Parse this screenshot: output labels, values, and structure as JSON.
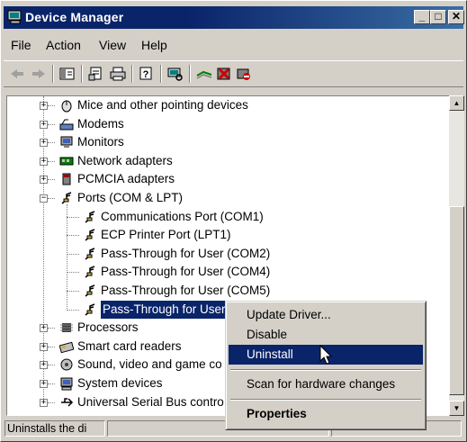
{
  "window": {
    "title": "Device Manager"
  },
  "menubar": {
    "items": [
      "File",
      "Action",
      "View",
      "Help"
    ]
  },
  "toolbar": {
    "icons": [
      "back-icon",
      "forward-icon",
      "show-hide-tree-icon",
      "properties-icon",
      "print-icon",
      "help-icon",
      "scan-hardware-icon",
      "update-driver-icon",
      "uninstall-icon",
      "disable-icon"
    ]
  },
  "tree": {
    "categories_top": [
      {
        "label": "Mice and other pointing devices",
        "icon": "mouse-icon"
      },
      {
        "label": "Modems",
        "icon": "modem-icon"
      },
      {
        "label": "Monitors",
        "icon": "monitor-icon"
      },
      {
        "label": "Network adapters",
        "icon": "network-adapter-icon"
      },
      {
        "label": "PCMCIA adapters",
        "icon": "pcmcia-icon"
      },
      {
        "label": "Ports (COM & LPT)",
        "icon": "port-icon"
      }
    ],
    "ports": [
      "Communications Port (COM1)",
      "ECP Printer Port (LPT1)",
      "Pass-Through for User (COM2)",
      "Pass-Through for User (COM4)",
      "Pass-Through for User (COM5)",
      "Pass-Through for User"
    ],
    "categories_bottom": [
      {
        "label": "Processors",
        "icon": "processor-icon"
      },
      {
        "label": "Smart card readers",
        "icon": "smart-card-icon"
      },
      {
        "label": "Sound, video and game co",
        "icon": "sound-icon"
      },
      {
        "label": "System devices",
        "icon": "system-devices-icon"
      },
      {
        "label": "Universal Serial Bus contro",
        "icon": "usb-icon"
      }
    ]
  },
  "context_menu": {
    "update_driver": "Update Driver...",
    "disable": "Disable",
    "uninstall": "Uninstall",
    "scan": "Scan for hardware changes",
    "properties": "Properties"
  },
  "status": {
    "text": "Uninstalls the di"
  },
  "colors": {
    "selection": "#0a246a",
    "face": "#d4d0c8"
  }
}
